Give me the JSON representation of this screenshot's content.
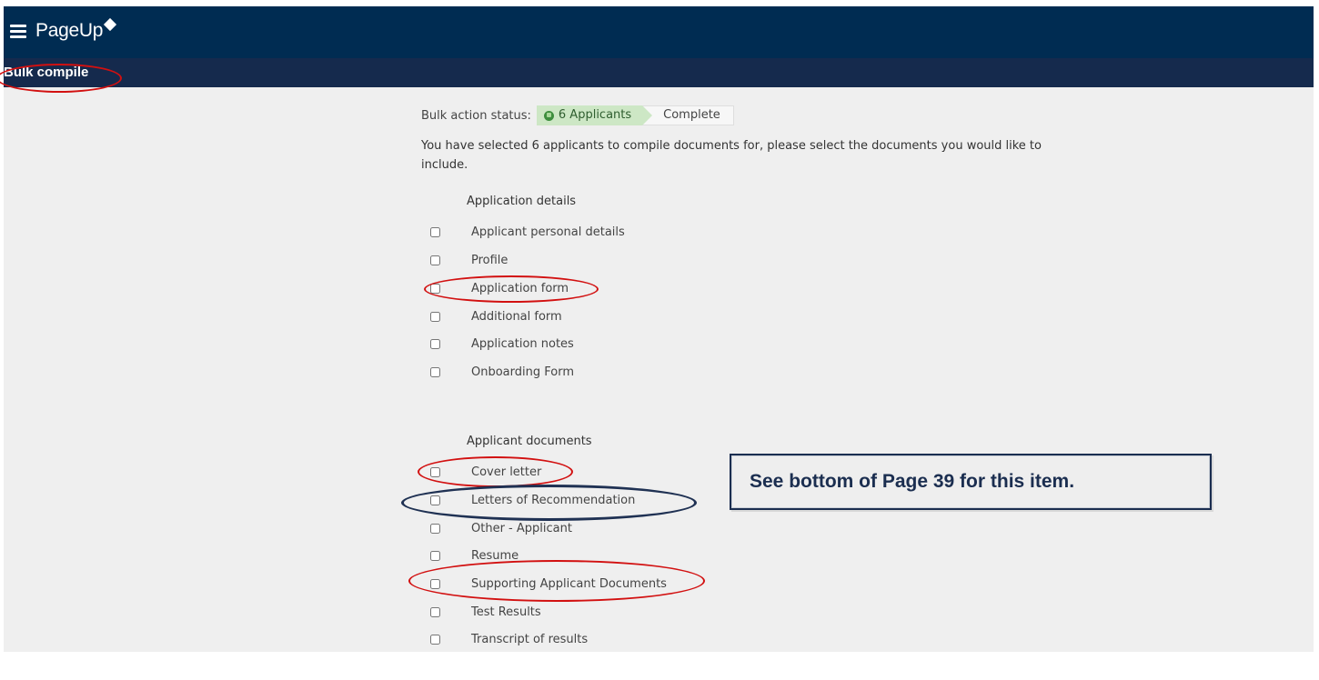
{
  "app": {
    "logo": "PageUp"
  },
  "page_title": "Bulk compile",
  "status": {
    "label": "Bulk action status:",
    "step1": "6 Applicants",
    "step2": "Complete"
  },
  "intro": "You have selected 6 applicants to compile documents for, please select the documents you would like to include.",
  "sections": [
    {
      "heading": "Application details",
      "items": [
        {
          "label": "Applicant personal details",
          "checked": false
        },
        {
          "label": "Profile",
          "checked": false
        },
        {
          "label": "Application form",
          "checked": false
        },
        {
          "label": "Additional form",
          "checked": false
        },
        {
          "label": "Application notes",
          "checked": false
        },
        {
          "label": "Onboarding Form",
          "checked": false
        }
      ]
    },
    {
      "heading": "Applicant documents",
      "items": [
        {
          "label": "Cover letter",
          "checked": false
        },
        {
          "label": "Letters of Recommendation",
          "checked": false
        },
        {
          "label": "Other - Applicant",
          "checked": false
        },
        {
          "label": "Resume",
          "checked": false
        },
        {
          "label": "Supporting Applicant Documents",
          "checked": false
        },
        {
          "label": "Test Results",
          "checked": false
        },
        {
          "label": "Transcript of results",
          "checked": false
        }
      ]
    }
  ],
  "callout": {
    "text": "See bottom of Page 39 for this item."
  },
  "colors": {
    "topbar": "#002c52",
    "subbar": "#152a4d",
    "highlight_red": "#d21010",
    "highlight_navy": "#1f3153",
    "status_green": "#cde7c5"
  },
  "icons": [
    "hamburger-menu-icon",
    "logo-diamond-icon",
    "applicants-step-icon"
  ]
}
